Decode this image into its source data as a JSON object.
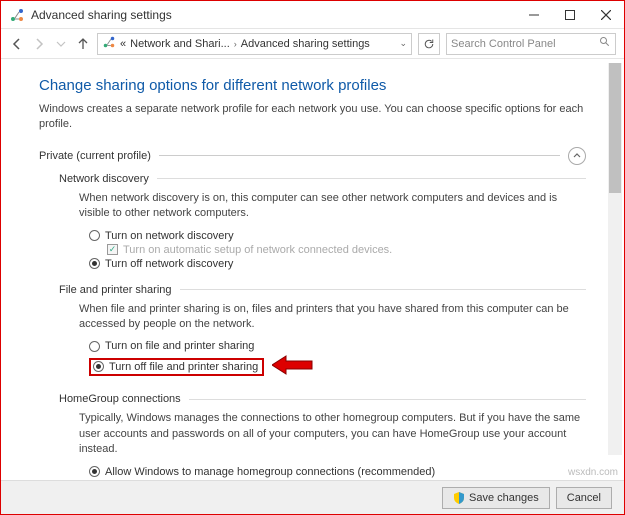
{
  "window": {
    "title": "Advanced sharing settings"
  },
  "breadcrumb": {
    "prefix": "«",
    "item1": "Network and Shari...",
    "item2": "Advanced sharing settings"
  },
  "search": {
    "placeholder": "Search Control Panel"
  },
  "page": {
    "title": "Change sharing options for different network profiles",
    "description": "Windows creates a separate network profile for each network you use. You can choose specific options for each profile."
  },
  "profile": {
    "label": "Private (current profile)"
  },
  "network_discovery": {
    "heading": "Network discovery",
    "description": "When network discovery is on, this computer can see other network computers and devices and is visible to other network computers.",
    "opt_on": "Turn on network discovery",
    "opt_auto": "Turn on automatic setup of network connected devices.",
    "opt_off": "Turn off network discovery"
  },
  "file_sharing": {
    "heading": "File and printer sharing",
    "description": "When file and printer sharing is on, files and printers that you have shared from this computer can be accessed by people on the network.",
    "opt_on": "Turn on file and printer sharing",
    "opt_off": "Turn off file and printer sharing"
  },
  "homegroup": {
    "heading": "HomeGroup connections",
    "description": "Typically, Windows manages the connections to other homegroup computers. But if you have the same user accounts and passwords on all of your computers, you can have HomeGroup use your account instead.",
    "opt_allow": "Allow Windows to manage homegroup connections (recommended)"
  },
  "footer": {
    "save": "Save changes",
    "cancel": "Cancel"
  },
  "watermark": "wsxdn.com"
}
